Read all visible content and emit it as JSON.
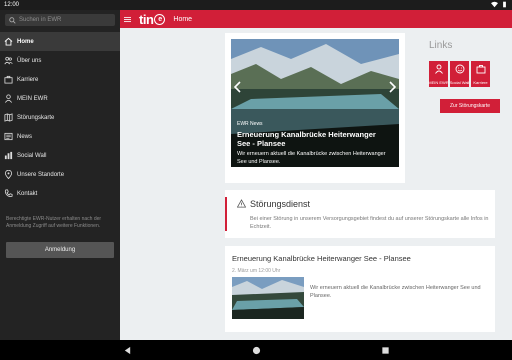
{
  "statusbar": {
    "time": "12:00"
  },
  "drawer": {
    "search_placeholder": "Suchen in EWR",
    "items": [
      {
        "label": "Home",
        "icon": "home-icon",
        "active": true
      },
      {
        "label": "Über uns",
        "icon": "people-icon"
      },
      {
        "label": "Karriere",
        "icon": "briefcase-icon"
      },
      {
        "label": "MEIN EWR",
        "icon": "person-icon"
      },
      {
        "label": "Störungskarte",
        "icon": "map-icon"
      },
      {
        "label": "News",
        "icon": "newspaper-icon"
      },
      {
        "label": "Social Wall",
        "icon": "chart-icon"
      },
      {
        "label": "Unsere Standorte",
        "icon": "pin-icon"
      },
      {
        "label": "Kontakt",
        "icon": "phone-icon"
      }
    ],
    "note": "Berechtigte EWR-Nutzer erhalten nach der Anmeldung Zugriff auf weitere Funktionen.",
    "login_label": "Anmeldung"
  },
  "appbar": {
    "logo_text": "tin",
    "logo_circle": "e",
    "title": "Home"
  },
  "slider": {
    "tag": "EWR News",
    "headline": "Erneuerung Kanalbrücke Heiterwanger See - Plansee",
    "teaser": "Wir erneuern aktuell die Kanalbrücke zwischen Heiterwanger See und Plansee."
  },
  "links": {
    "title": "Links",
    "tiles": [
      {
        "label": "MEIN EWR",
        "icon": "person-icon"
      },
      {
        "label": "Social Wall",
        "icon": "smiley-icon"
      },
      {
        "label": "Karriere",
        "icon": "briefcase-icon"
      }
    ],
    "stoerung_button": "Zur Störungskarte"
  },
  "service": {
    "title": "Störungsdienst",
    "text": "Bei einer Störung in unserem Versorgungsgebiet findest du auf unserer Störungskarte alle Infos in Echtzeit."
  },
  "news": {
    "title": "Erneuerung Kanalbrücke Heiterwanger See - Plansee",
    "date": "2. März um 12:00 Uhr",
    "text": "Wir erneuern aktuell die Kanalbrücke zwischen Heiterwanger See und Plansee."
  },
  "colors": {
    "accent": "#d11f38",
    "drawer": "#232323"
  }
}
